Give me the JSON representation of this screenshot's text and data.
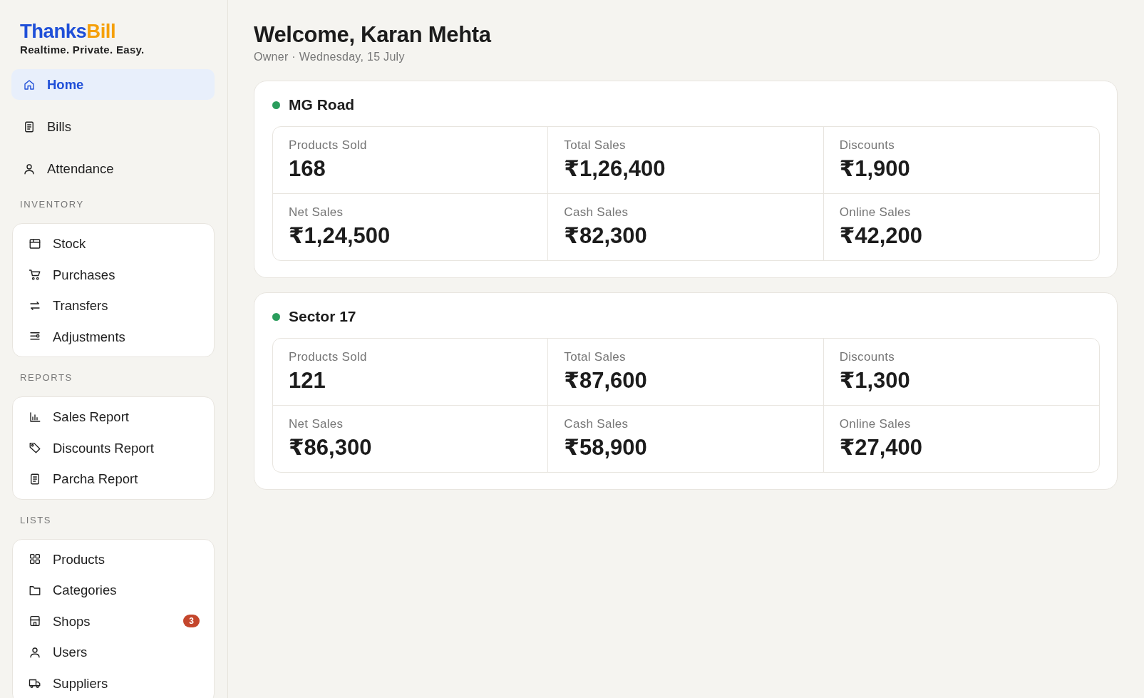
{
  "brand": {
    "name_parts": [
      "Thanks",
      "Bill"
    ],
    "tagline": "Realtime. Private. Easy."
  },
  "sidebar": {
    "main_items": [
      {
        "label": "Home",
        "selected": true
      },
      {
        "label": "Bills",
        "selected": false
      },
      {
        "label": "Attendance",
        "selected": false
      }
    ],
    "sections": [
      {
        "title": "INVENTORY",
        "items": [
          {
            "label": "Stock",
            "selected": false
          },
          {
            "label": "Purchases",
            "selected": false
          },
          {
            "label": "Transfers",
            "selected": false
          },
          {
            "label": "Adjustments",
            "selected": false
          }
        ]
      },
      {
        "title": "REPORTS",
        "items": [
          {
            "label": "Sales Report",
            "selected": false
          },
          {
            "label": "Discounts Report",
            "selected": false
          },
          {
            "label": "Parcha Report",
            "selected": false
          }
        ]
      },
      {
        "title": "LISTS",
        "items": [
          {
            "label": "Products",
            "selected": false
          },
          {
            "label": "Categories",
            "selected": false
          },
          {
            "label": "Shops",
            "selected": false,
            "badge": "3"
          },
          {
            "label": "Users",
            "selected": false
          },
          {
            "label": "Suppliers",
            "selected": false
          }
        ]
      }
    ]
  },
  "header": {
    "title": "Welcome, Karan Mehta",
    "subtitle": "Owner · Wednesday, 15 July"
  },
  "shops": [
    {
      "name": "MG Road",
      "active": true,
      "stats": [
        {
          "label": "Products Sold",
          "value": "168"
        },
        {
          "label": "Total Sales",
          "value": "₹1,26,400"
        },
        {
          "label": "Discounts",
          "value": "₹1,900"
        },
        {
          "label": "Net Sales",
          "value": "₹1,24,500"
        },
        {
          "label": "Cash Sales",
          "value": "₹82,300"
        },
        {
          "label": "Online Sales",
          "value": "₹42,200"
        }
      ]
    },
    {
      "name": "Sector 17",
      "active": true,
      "stats": [
        {
          "label": "Products Sold",
          "value": "121"
        },
        {
          "label": "Total Sales",
          "value": "₹87,600"
        },
        {
          "label": "Discounts",
          "value": "₹1,300"
        },
        {
          "label": "Net Sales",
          "value": "₹86,300"
        },
        {
          "label": "Cash Sales",
          "value": "₹58,900"
        },
        {
          "label": "Online Sales",
          "value": "₹27,400"
        }
      ]
    }
  ]
}
